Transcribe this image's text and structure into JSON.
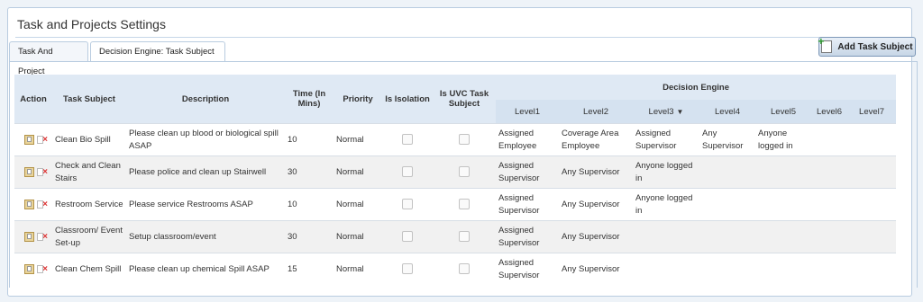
{
  "page": {
    "title": "Task and Projects Settings"
  },
  "tabs": [
    {
      "label": "Task And Project"
    },
    {
      "label": "Decision Engine: Task Subject"
    }
  ],
  "add_button": {
    "label": "Add Task Subject",
    "icon": "add-document-icon"
  },
  "table": {
    "headers": {
      "action": "Action",
      "task_subject": "Task Subject",
      "description": "Description",
      "time": "Time (In Mins)",
      "priority": "Priority",
      "is_isolation": "Is Isolation",
      "is_uvc": "Is UVC Task Subject",
      "decision_engine": "Decision Engine",
      "levels": [
        "Level1",
        "Level2",
        "Level3",
        "Level4",
        "Level5",
        "Level6",
        "Level7"
      ],
      "sort_indicator": "▼"
    },
    "rows": [
      {
        "subject": "Clean Bio Spill",
        "description": "Please clean up blood or biological spill ASAP",
        "time": "10",
        "priority": "Normal",
        "is_isolation": false,
        "is_uvc": false,
        "levels": [
          "Assigned Employee",
          "Coverage Area Employee",
          "Assigned Supervisor",
          "Any Supervisor",
          "Anyone logged in",
          "",
          ""
        ]
      },
      {
        "subject": "Check and Clean Stairs",
        "description": "Please police and clean up Stairwell",
        "time": "30",
        "priority": "Normal",
        "is_isolation": false,
        "is_uvc": false,
        "levels": [
          "Assigned Supervisor",
          "Any Supervisor",
          "Anyone logged in",
          "",
          "",
          "",
          ""
        ]
      },
      {
        "subject": "Restroom Service",
        "description": "Please service Restrooms ASAP",
        "time": "10",
        "priority": "Normal",
        "is_isolation": false,
        "is_uvc": false,
        "levels": [
          "Assigned Supervisor",
          "Any Supervisor",
          "Anyone logged in",
          "",
          "",
          "",
          ""
        ]
      },
      {
        "subject": "Classroom/ Event Set-up",
        "description": "Setup classroom/event",
        "time": "30",
        "priority": "Normal",
        "is_isolation": false,
        "is_uvc": false,
        "levels": [
          "Assigned Supervisor",
          "Any Supervisor",
          "",
          "",
          "",
          "",
          ""
        ]
      },
      {
        "subject": "Clean Chem Spill",
        "description": "Please clean up chemical Spill ASAP",
        "time": "15",
        "priority": "Normal",
        "is_isolation": false,
        "is_uvc": false,
        "levels": [
          "Assigned Supervisor",
          "Any Supervisor",
          "",
          "",
          "",
          "",
          ""
        ]
      }
    ]
  }
}
